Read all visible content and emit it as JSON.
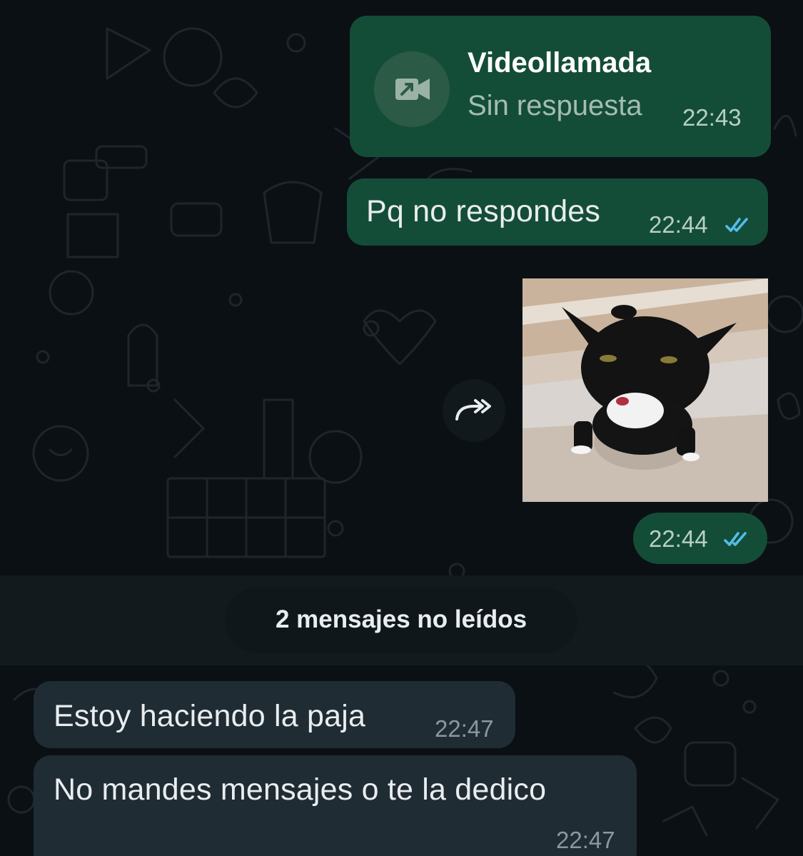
{
  "colors": {
    "background": "#0b1014",
    "outgoing_bubble": "#144d37",
    "incoming_bubble": "#202c33",
    "read_ticks": "#53bdeb"
  },
  "messages": [
    {
      "type": "call",
      "direction": "outgoing",
      "title": "Videollamada",
      "subtitle": "Sin respuesta",
      "time": "22:43",
      "icon": "video-camera-icon"
    },
    {
      "type": "text",
      "direction": "outgoing",
      "text": "Pq no respondes",
      "time": "22:44",
      "status": "read"
    },
    {
      "type": "image",
      "direction": "outgoing",
      "image": "black-and-white-cat-photo",
      "time": "22:44",
      "status": "read",
      "action_icon": "forward-icon"
    },
    {
      "type": "text",
      "direction": "incoming",
      "text": "Estoy haciendo la paja",
      "time": "22:47"
    },
    {
      "type": "text",
      "direction": "incoming",
      "text": "No mandes mensajes o te la dedico",
      "time": "22:47"
    }
  ],
  "unread_divider": {
    "label": "2 mensajes no leídos"
  }
}
